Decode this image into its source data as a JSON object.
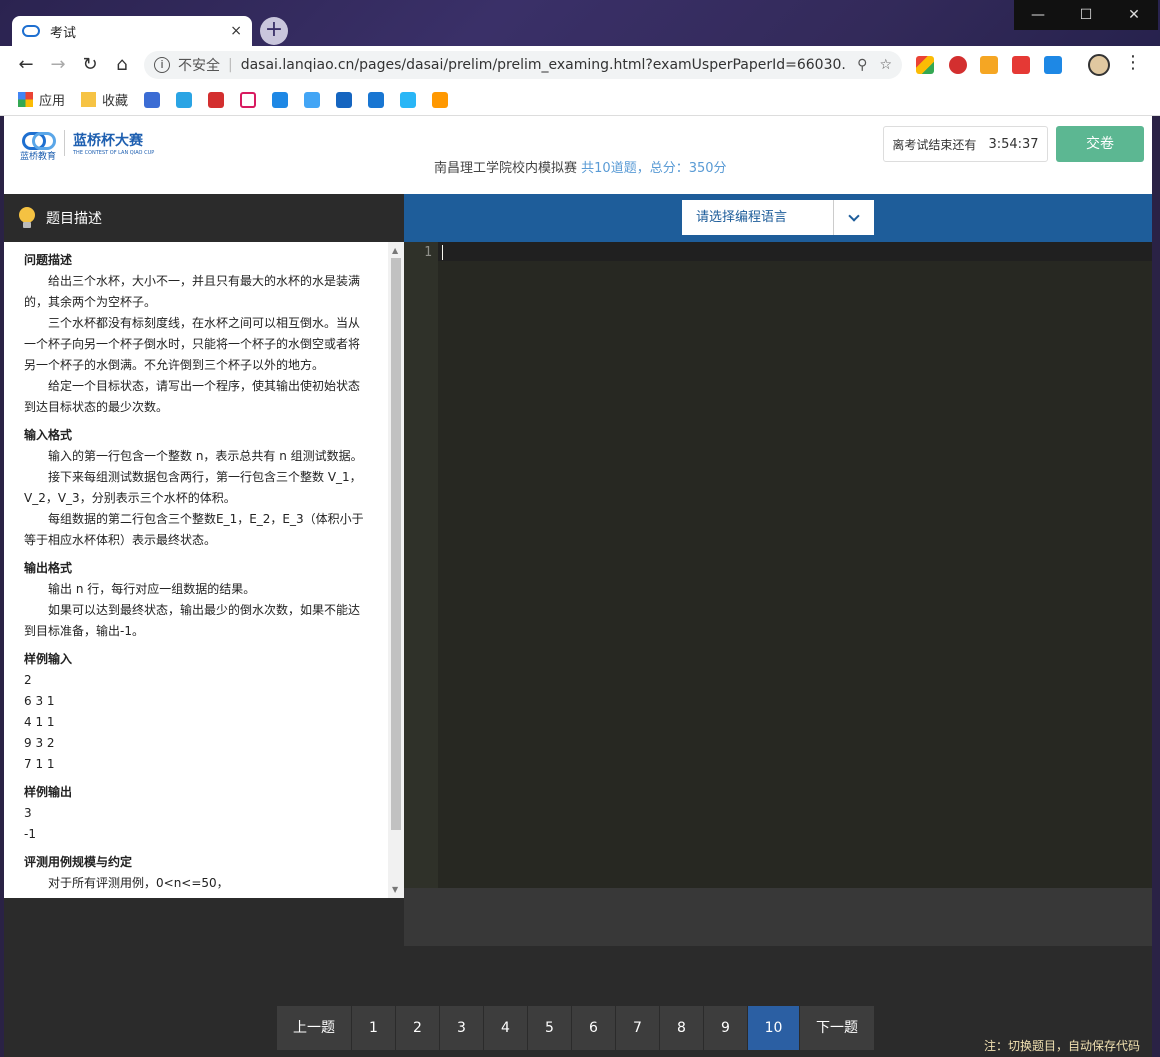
{
  "browser": {
    "tab_title": "考试",
    "tab_close": "×",
    "new_tab": "+",
    "window_controls": [
      "—",
      "☐",
      "✕"
    ],
    "insecure_label": "不安全",
    "url": "dasai.lanqiao.cn/pages/dasai/prelim/prelim_examing.html?examUsperPaperId=66030...",
    "bookmarks": {
      "apps": "应用",
      "favorites": "收藏"
    }
  },
  "header": {
    "logo_brand_small": "蓝桥教育",
    "logo_brand": "蓝桥杯大赛",
    "logo_subtitle": "THE CONTEST OF LAN QIAO CUP",
    "exam_name": "南昌理工学院校内模拟赛",
    "exam_summary": "共10道题，总分：350分",
    "timer_label": "离考试结束还有",
    "timer_value": "3:54:37",
    "submit_label": "交卷"
  },
  "problem": {
    "panel_title": "题目描述",
    "sections": {
      "desc_title": "问题描述",
      "desc_p1": "给出三个水杯，大小不一，并且只有最大的水杯的水是装满的，其余两个为空杯子。",
      "desc_p2": "三个水杯都没有标刻度线，在水杯之间可以相互倒水。当从一个杯子向另一个杯子倒水时，只能将一个杯子的水倒空或者将另一个杯子的水倒满。不允许倒到三个杯子以外的地方。",
      "desc_p3": "给定一个目标状态，请写出一个程序，使其输出使初始状态到达目标状态的最少次数。",
      "input_title": "输入格式",
      "input_p1": "输入的第一行包含一个整数 n，表示总共有 n 组测试数据。",
      "input_p2": "接下来每组测试数据包含两行，第一行包含三个整数 V_1，V_2，V_3，分别表示三个水杯的体积。",
      "input_p3": "每组数据的第二行包含三个整数E_1，E_2，E_3（体积小于等于相应水杯体积）表示最终状态。",
      "output_title": "输出格式",
      "output_p1": "输出 n 行，每行对应一组数据的结果。",
      "output_p2": "如果可以达到最终状态，输出最少的倒水次数，如果不能达到目标准备，输出-1。",
      "sample_in_title": "样例输入",
      "sample_in": [
        "2",
        "6 3 1",
        "4 1 1",
        "9 3 2",
        "7 1 1"
      ],
      "sample_out_title": "样例输出",
      "sample_out": [
        "3",
        "-1"
      ],
      "scale_title": "评测用例规模与约定",
      "scale_p1": "对于所有评测用例，0<n<=50，"
    }
  },
  "editor": {
    "language_placeholder": "请选择编程语言",
    "line_number": "1"
  },
  "pager": {
    "prev": "上一题",
    "next": "下一题",
    "pages": [
      "1",
      "2",
      "3",
      "4",
      "5",
      "6",
      "7",
      "8",
      "9",
      "10"
    ],
    "active_page": "10",
    "note": "注：切换题目，自动保存代码"
  },
  "colors": {
    "editor_bg": "#272822",
    "topbar_blue": "#1e5d9a",
    "submit_green": "#5cb792",
    "active_page": "#2b5fa3"
  }
}
